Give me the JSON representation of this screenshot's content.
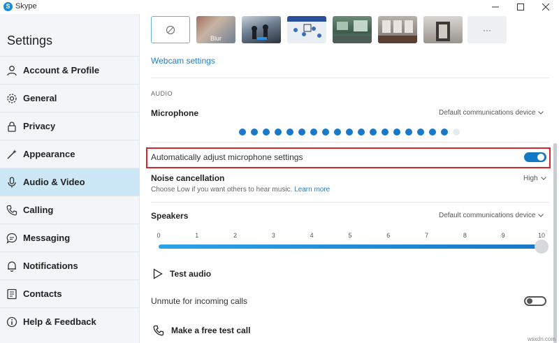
{
  "window": {
    "title": "Skype",
    "app_icon_letter": "S"
  },
  "sidebar": {
    "heading": "Settings",
    "items": [
      {
        "label": "Account & Profile",
        "icon": "person-icon"
      },
      {
        "label": "General",
        "icon": "gear-icon"
      },
      {
        "label": "Privacy",
        "icon": "lock-icon"
      },
      {
        "label": "Appearance",
        "icon": "wand-icon"
      },
      {
        "label": "Audio & Video",
        "icon": "microphone-icon",
        "active": true
      },
      {
        "label": "Calling",
        "icon": "phone-icon"
      },
      {
        "label": "Messaging",
        "icon": "chat-icon"
      },
      {
        "label": "Notifications",
        "icon": "bell-icon"
      },
      {
        "label": "Contacts",
        "icon": "contacts-icon"
      },
      {
        "label": "Help & Feedback",
        "icon": "info-icon"
      }
    ]
  },
  "video": {
    "backgrounds": [
      "none",
      "Blur",
      "image-1",
      "image-2",
      "image-3",
      "image-4",
      "image-5",
      "more"
    ],
    "blur_label": "Blur",
    "more_label": "···",
    "webcam_settings_link": "Webcam settings"
  },
  "audio": {
    "section_label": "AUDIO",
    "microphone": {
      "title": "Microphone",
      "device": "Default communications device",
      "level_dots_total": 19,
      "level_dots_active": 18
    },
    "auto_adjust": {
      "label": "Automatically adjust microphone settings",
      "enabled": true
    },
    "noise_cancellation": {
      "title": "Noise cancellation",
      "value": "High",
      "description": "Choose Low if you want others to hear music.",
      "learn_more": "Learn more"
    },
    "speakers": {
      "title": "Speakers",
      "device": "Default communications device",
      "ticks": [
        "0",
        "1",
        "2",
        "3",
        "4",
        "5",
        "6",
        "7",
        "8",
        "9",
        "10"
      ],
      "volume": 10
    },
    "test_audio": "Test audio",
    "unmute_incoming": {
      "label": "Unmute for incoming calls",
      "enabled": false
    },
    "free_test_call": "Make a free test call"
  },
  "watermark": "wsxdn.com",
  "colors": {
    "accent": "#1479c4",
    "highlight_border": "#d6262e",
    "sidebar_bg": "#f3f5f8",
    "active_item": "#cce8f7"
  }
}
